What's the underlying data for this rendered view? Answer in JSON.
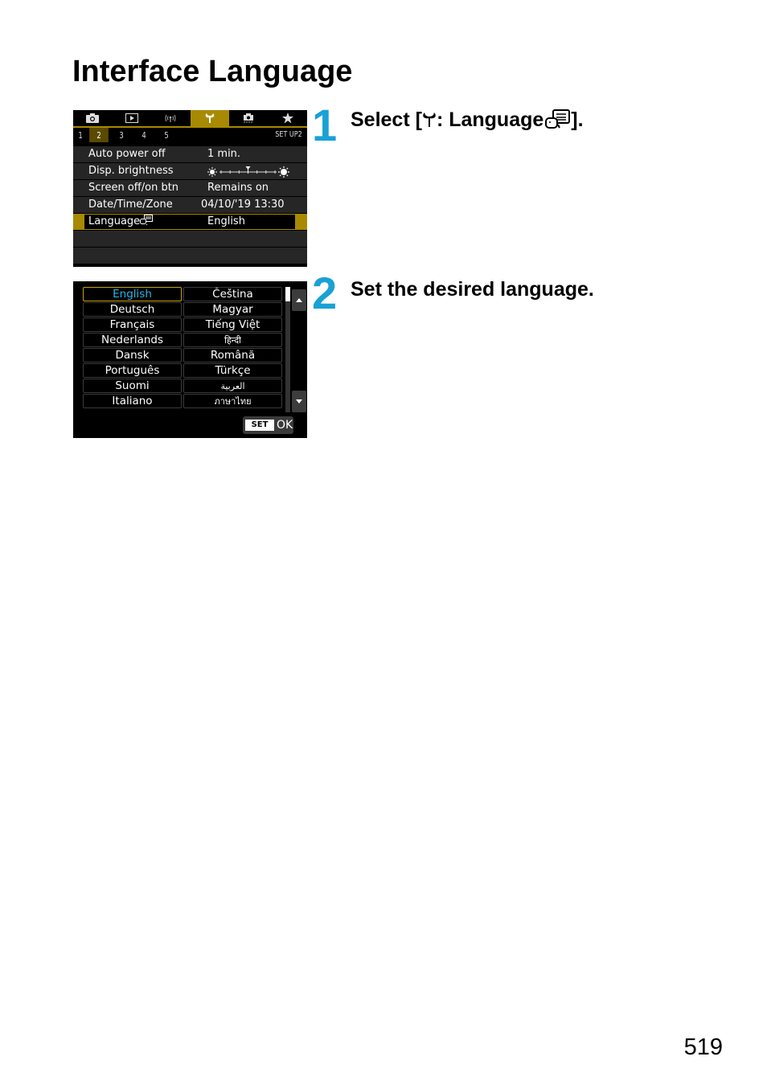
{
  "page": {
    "title": "Interface Language",
    "page_number": "519"
  },
  "steps": [
    {
      "number": "1",
      "text_before": "Select [",
      "wrench_icon": "setup-wrench-icon",
      "text_middle": ": Language",
      "language_icon": "language-speech-icon",
      "text_after": "]."
    },
    {
      "number": "2",
      "text": "Set the desired language."
    }
  ],
  "setup_screen": {
    "main_tabs": [
      {
        "icon": "camera-icon",
        "active": false
      },
      {
        "icon": "playback-icon",
        "active": false
      },
      {
        "icon": "wireless-icon",
        "active": false
      },
      {
        "icon": "wrench-icon",
        "active": true
      },
      {
        "icon": "custom-function-icon",
        "active": false
      },
      {
        "icon": "star-icon",
        "active": false
      }
    ],
    "sub_tabs": [
      "1",
      "2",
      "3",
      "4",
      "5"
    ],
    "active_sub_tab": "2",
    "sub_tab_label": "SET UP2",
    "items": [
      {
        "label": "Auto power off",
        "value": "1 min."
      },
      {
        "label": "Disp. brightness",
        "value": "",
        "brightness_level": 4,
        "brightness_max": 7
      },
      {
        "label": "Screen off/on btn",
        "value": "Remains on"
      },
      {
        "label": "Date/Time/Zone",
        "value": "04/10/'19 13:30"
      },
      {
        "label": "Language",
        "value": "English",
        "selected": true
      }
    ],
    "accent_color": "#a88a00"
  },
  "language_screen": {
    "languages": [
      "English",
      "Čeština",
      "Deutsch",
      "Magyar",
      "Français",
      "Tiếng Việt",
      "Nederlands",
      "हिन्दी",
      "Dansk",
      "Română",
      "Português",
      "Türkçe",
      "Suomi",
      "العربية",
      "Italiano",
      "ภาษาไทย"
    ],
    "selected": "English",
    "selected_color": "#27b7e8",
    "set_label": "SET",
    "ok_label": "OK"
  }
}
